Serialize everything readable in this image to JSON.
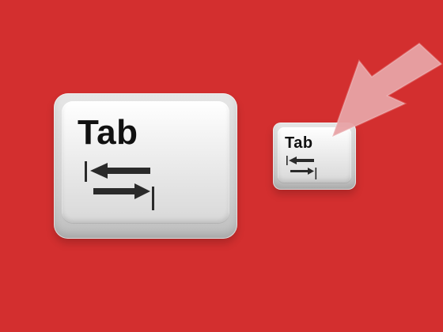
{
  "keys": {
    "large": {
      "label": "Tab",
      "icon": "tab-icon"
    },
    "small": {
      "label": "Tab",
      "icon": "tab-icon"
    }
  },
  "pointer": {
    "icon": "pointer-arrow-icon",
    "color": "#e8a3a6"
  },
  "colors": {
    "background": "#d32f2f",
    "key_text": "#111111",
    "icon": "#2a2a2a"
  }
}
